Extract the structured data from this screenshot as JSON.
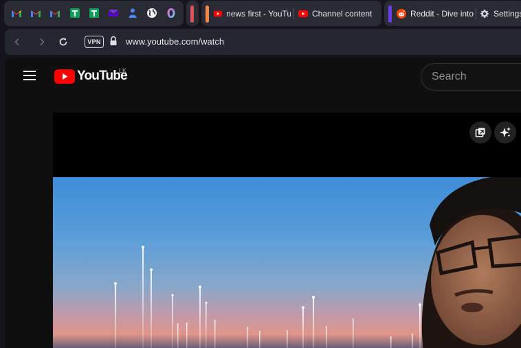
{
  "tabs": {
    "pinned": [
      "gmail-icon",
      "gmail-icon",
      "gmail-icon",
      "google-sheets-icon",
      "google-sheets-icon",
      "yahoo-mail-icon",
      "people-icon",
      "globe-icon",
      "opera-aria-icon"
    ],
    "group_colors": [
      "#e0505a",
      "#f0884a",
      "#6a3cf0"
    ],
    "items": [
      {
        "label": "news first - YouTube",
        "icon": "youtube-icon"
      },
      {
        "label": "Channel content",
        "icon": "youtube-icon"
      },
      {
        "label": "Reddit - Dive into",
        "icon": "reddit-icon"
      },
      {
        "label": "Settings",
        "icon": "gear-icon"
      }
    ]
  },
  "address_bar": {
    "vpn_label": "VPN",
    "url": "www.youtube.com/watch"
  },
  "youtube": {
    "logo_text": "YouTube",
    "country_code": "LK",
    "search_placeholder": "Search"
  },
  "player": {
    "buttons": [
      "miniplayer-icon",
      "ask-ai-sparkle-icon"
    ]
  },
  "colors": {
    "youtube_red": "#ff0000",
    "reddit_orange": "#ff4500"
  }
}
